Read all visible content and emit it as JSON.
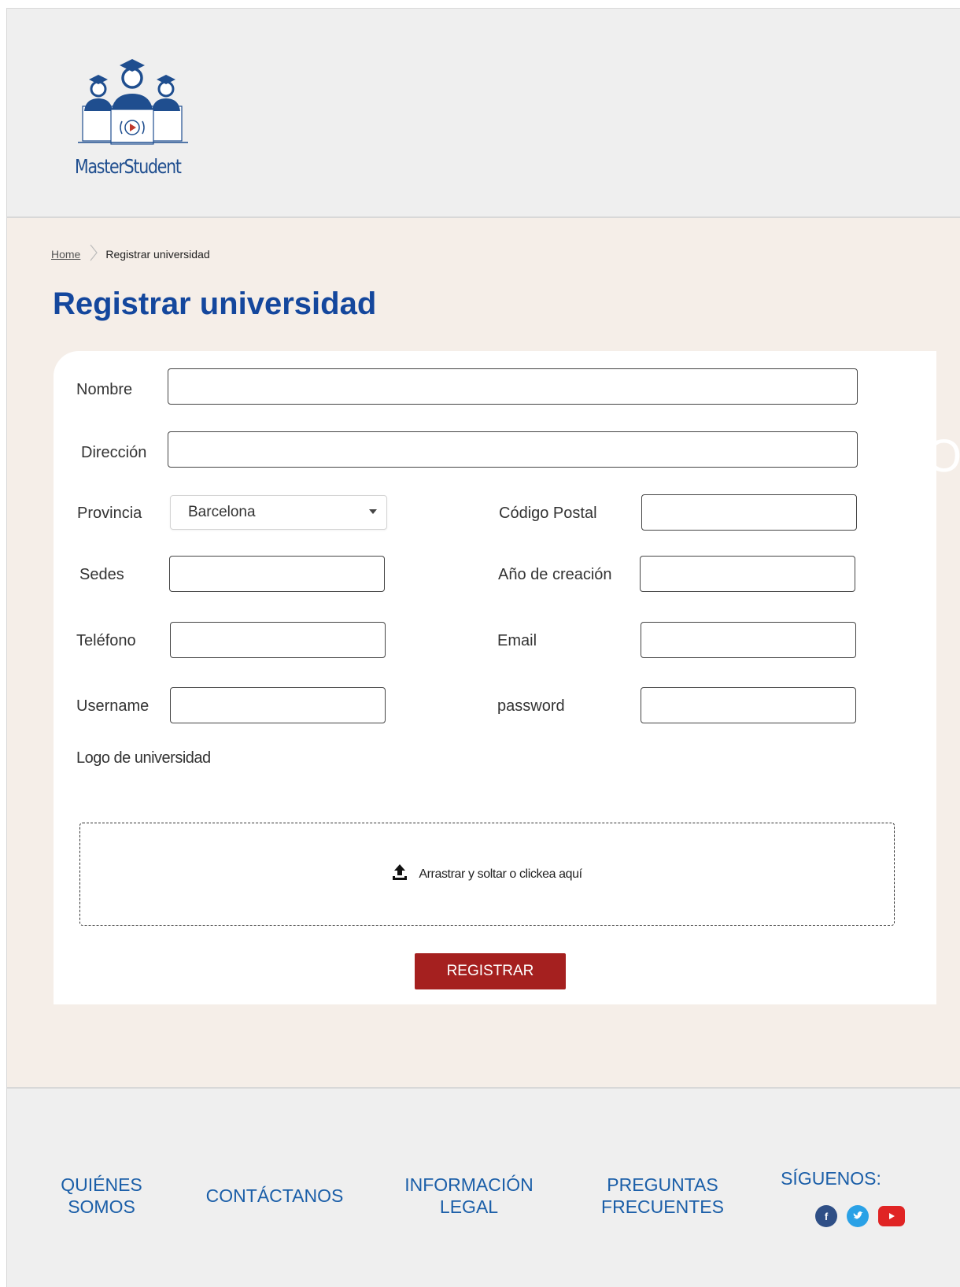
{
  "brand": {
    "name": "MasterStudent"
  },
  "breadcrumb": {
    "home": "Home",
    "current": "Registrar universidad"
  },
  "page": {
    "title": "Registrar universidad"
  },
  "form": {
    "nombre_label": "Nombre",
    "direccion_label": "Dirección",
    "provincia_label": "Provincia",
    "provincia_value": "Barcelona",
    "codigo_postal_label": "Código Postal",
    "sedes_label": "Sedes",
    "anio_label": "Año de creación",
    "telefono_label": "Teléfono",
    "email_label": "Email",
    "username_label": "Username",
    "password_label": "password",
    "logo_label": "Logo de universidad",
    "dropzone_text": "Arrastrar y soltar o clickea aquí",
    "submit_label": "REGISTRAR"
  },
  "footer": {
    "links": [
      {
        "line1": "QUIÉNES",
        "line2": "SOMOS"
      },
      {
        "line1": "CONTÁCTANOS",
        "line2": ""
      },
      {
        "line1": "INFORMACIÓN",
        "line2": "LEGAL"
      },
      {
        "line1": "PREGUNTAS",
        "line2": "FRECUENTES"
      }
    ],
    "follow_label": "SÍGUENOS:",
    "social": [
      "facebook-icon",
      "twitter-icon",
      "youtube-icon"
    ]
  },
  "colors": {
    "primary": "#14479d",
    "link": "#1a5ea8",
    "button": "#a5201f",
    "header_bg": "#efefef",
    "page_bg": "#f5eee8"
  }
}
